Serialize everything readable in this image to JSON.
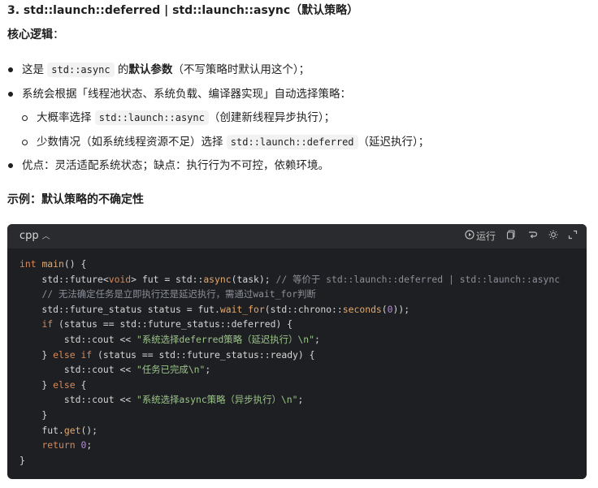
{
  "heading": "3. std::launch::deferred | std::launch::async（默认策略）",
  "core_logic_label": "核心逻辑",
  "core_logic_colon": "：",
  "bullets": {
    "b1": {
      "pre": "这是 ",
      "code": "std::async",
      "mid": " 的",
      "bold": "默认参数",
      "post": "（不写策略时默认用这个）；"
    },
    "b2": {
      "text": "系统会根据「线程池状态、系统负载、编译器实现」自动选择策略："
    },
    "sub1": {
      "pre": "大概率选择 ",
      "code": "std::launch::async",
      "post": "（创建新线程异步执行）；"
    },
    "sub2": {
      "pre": "少数情况（如系统线程资源不足）选择 ",
      "code": "std::launch::deferred",
      "post": "（延迟执行）；"
    },
    "b3": {
      "text": "优点：灵活适配系统状态；缺点：执行行为不可控，依赖环境。"
    }
  },
  "example_heading": "示例：默认策略的不确定性",
  "code_block": {
    "language": "cpp",
    "run_label": "运行",
    "icons": [
      "play-icon",
      "copy-icon",
      "wrap-icon",
      "theme-icon",
      "expand-icon"
    ],
    "lines": [
      "int main() {",
      "    std::future<void> fut = std::async(task); // 等价于 std::launch::deferred | std::launch::async",
      "    // 无法确定任务是立即执行还是延迟执行，需通过wait_for判断",
      "    std::future_status status = fut.wait_for(std::chrono::seconds(0));",
      "    if (status == std::future_status::deferred) {",
      "        std::cout << \"系统选择deferred策略（延迟执行）\\n\";",
      "    } else if (status == std::future_status::ready) {",
      "        std::cout << \"任务已完成\\n\";",
      "    } else {",
      "        std::cout << \"系统选择async策略（异步执行）\\n\";",
      "    }",
      "    fut.get();",
      "    return 0;",
      "}"
    ]
  }
}
